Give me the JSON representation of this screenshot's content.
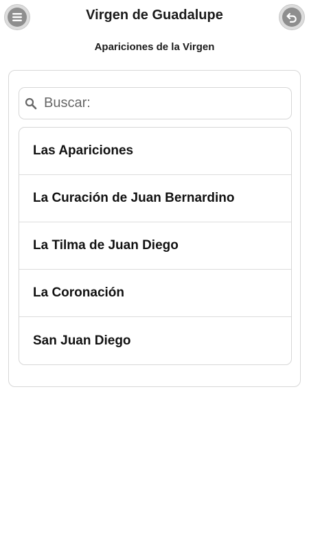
{
  "header": {
    "title": "Virgen de Guadalupe",
    "menu_icon": "hamburger-menu-icon",
    "back_icon": "undo-back-icon"
  },
  "subtitle": "Apariciones de la Virgen",
  "search": {
    "placeholder": "Buscar:",
    "value": "",
    "icon": "search-icon"
  },
  "list": {
    "items": [
      {
        "label": "Las Apariciones"
      },
      {
        "label": "La Curación de Juan Bernardino"
      },
      {
        "label": "La Tilma de Juan Diego"
      },
      {
        "label": "La Coronación"
      },
      {
        "label": "San Juan Diego"
      }
    ]
  },
  "colors": {
    "button_bg": "#dcdcdc",
    "button_inner": "#8e8e8e",
    "border": "#d6d6d6"
  }
}
